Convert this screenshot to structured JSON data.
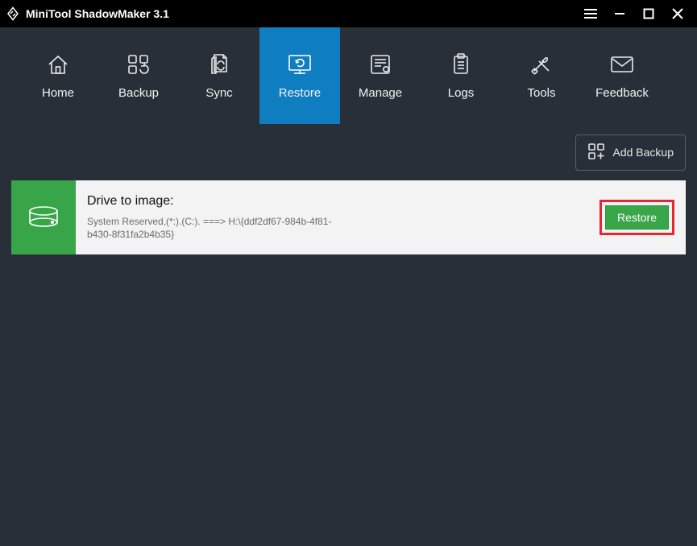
{
  "titlebar": {
    "title": "MiniTool ShadowMaker 3.1"
  },
  "nav": {
    "items": [
      {
        "label": "Home"
      },
      {
        "label": "Backup"
      },
      {
        "label": "Sync"
      },
      {
        "label": "Restore"
      },
      {
        "label": "Manage"
      },
      {
        "label": "Logs"
      },
      {
        "label": "Tools"
      },
      {
        "label": "Feedback"
      }
    ]
  },
  "toolbar": {
    "add_backup_label": "Add Backup"
  },
  "card": {
    "title": "Drive to image:",
    "detail_line1": " System Reserved,(*:).(C:). ===> H:\\{ddf2df67-984b-4f81-",
    "detail_line2": "b430-8f31fa2b4b35}",
    "restore_label": "Restore"
  }
}
